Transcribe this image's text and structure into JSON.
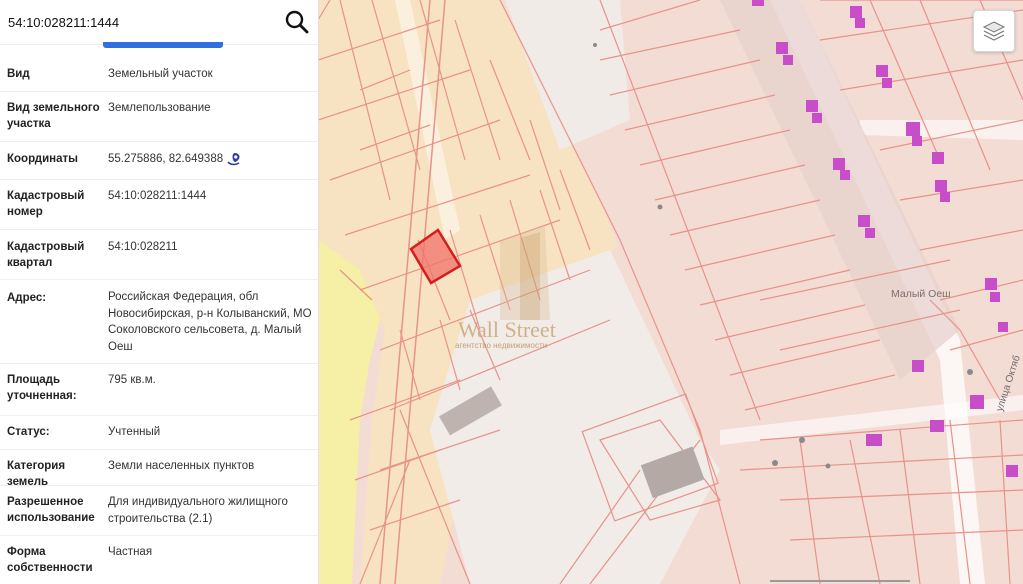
{
  "search": {
    "value": "54:10:028211:1444"
  },
  "details": [
    {
      "label": "Вид",
      "value": "Земельный участок"
    },
    {
      "label": "Вид земельного участка",
      "value": "Землепользование"
    },
    {
      "label": "Координаты",
      "value": "55.275886, 82.649388"
    },
    {
      "label": "Кадастровый номер",
      "value": "54:10:028211:1444"
    },
    {
      "label": "Кадастровый квартал",
      "value": "54:10:028211"
    },
    {
      "label": "Адрес:",
      "value": "Российская Федерация, обл Новосибирская, р-н Колыванский, МО Соколовского сельсовета, д. Малый Оеш"
    },
    {
      "label": "Площадь уточненная:",
      "value": "795 кв.м."
    },
    {
      "label": "Статус:",
      "value": "Учтенный"
    },
    {
      "label": "Категория земель",
      "value": "Земли населенных пунктов"
    },
    {
      "label": "Разрешенное использование",
      "value": "Для индивидуального жилищного строительства (2.1)"
    },
    {
      "label": "Форма собственности",
      "value": "Частная"
    }
  ],
  "map": {
    "place_label": "Малый Оеш",
    "street_label": "улица Октяб",
    "watermark_title": "Wall Street",
    "watermark_subtitle": "агентство недвижимости",
    "colors": {
      "parcel_fill": "#f7e3c2",
      "block_fill": "#f3dcd4",
      "parcel_line": "#e8928a",
      "selected_parcel": "#d61e1e",
      "building": "#c84dc8",
      "yellow_zone": "#f6efa6"
    }
  }
}
